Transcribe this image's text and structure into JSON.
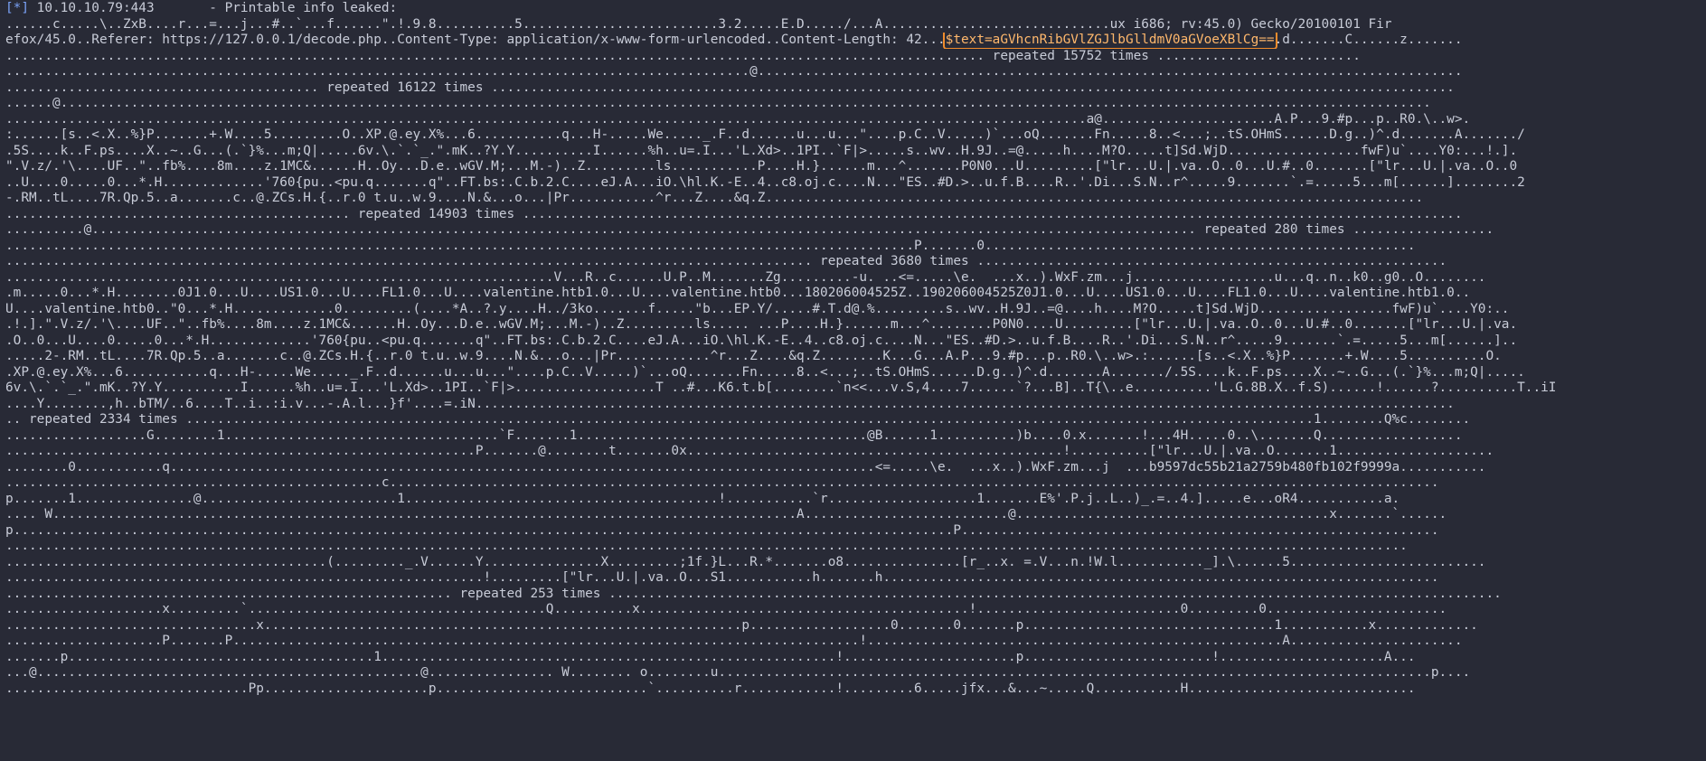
{
  "terminal": {
    "header": {
      "prefix": "[*]",
      "rest": " 10.10.10.79:443       - Printable info leaked:"
    },
    "line_2": {
      "before": "......c.....\\..ZxB....r...=...j...#..`...f......\".!.9.8..........5.........................3.2.....E.D...../...A.............................ux i686; rv:45.0) Gecko/20100101 Fir",
      "after": ""
    },
    "line_3": {
      "before": "efox/45.0..Referer: https://127.0.0.1/decode.php..Content-Type: application/x-www-form-urlencoded..Content-Length: 42...",
      "leak": "$text=aGVhcnRibGVlZGJlbGlldmV0aGVoeXBlCg==",
      "after": ".d.......C......z......."
    },
    "lines": [
      "............................................................................................................................. repeated 15752 times ..........................",
      "...............................................................................................@..........................................................................................",
      "........................................ repeated 16122 times ...........................................................................................................................",
      "......@...............................................................................................................................................................................",
      "..........................................................................................................................................a@......................A.P...9.#p...p..R0.\\..w>.",
      ":......[s..<.X..%}P.......+.W....5.........O..XP.@.ey.X%...6...........q...H-.....We....._.F..d......u...u...\"....p.C..V.....)`...oQ.......Fn.....8..<...;..tS.OHmS......D.g..)^.d.......A......./",
      ".5S....k..F.ps....X..~..G...(.`}%...m;Q|.....6v.\\.`.`_.\".mK..?Y.Y..........I......%h..u=.I...'L.Xd>..1PI..`F|>.....s..wv..H.9J..=@.....h....M?O.....t]Sd.WjD.................fwF)u`....Y0:...!.].",
      "\".V.z/.'\\....UF..\"..fb%....8m....z.1MC&......H..Oy...D.e..wGV.M;...M.-)..Z.........ls...........P....H.}......m...^.......P0N0...U.........[\"lr...U.|.va..O..0...U.#..0.......[\"lr...U.|.va..O..0",
      "..U....0.....0...*.H.............'760{pu..<pu.q.......q\"..FT.bs:.C.b.2.C....eJ.A...iO.\\hl.K.-E..4..c8.oj.c....N...\"ES..#D.>..u.f.B....R..'.Di...S.N..r^.....9.......`.=.....5...m[......]........2",
      "-.RM..tL....7R.Qp.5..a.......c..@.ZCs.H.{..r.0 t.u..w.9....N.&...o...|Pr...........^r...Z....&q.Z....................................................................................",
      "............................................ repeated 14903 times ........................................................................................................................",
      "..........@............................................................................................................................................. repeated 280 times ..................",
      "....................................................................................................................P.......0.......................................................",
      "....................................................................................................... repeated 3680 times ............................................................",
      "......................................................................V...R..c......U.P..M.......Zg.........-u. ..<=.....\\e.  ...x..).WxF.zm...j..................u...q..n..k0..g0..O........",
      ".m.....0...*.H........0J1.0...U....US1.0...U....FL1.0...U....valentine.htb1.0...U....valentine.htb0...180206004525Z..190206004525Z0J1.0...U....US1.0...U....FL1.0...U....valentine.htb1.0..",
      "U....valentine.htb0..\"0...*.H.............0.........(....*A..?.y....H../3ko.......f.....\"b...EP.Y/.....#.T.d@.%.........s..wv..H.9J..=@....h....M?O.....t]Sd.WjD.................fwF)u`....Y0:..",
      ".!.].\".V.z/.'\\....UF..\"..fb%....8m....z.1MC&......H..Oy...D.e..wGV.M;...M.-)..Z.........ls..... ...P....H.}......m...^........P0N0....U.........[\"lr...U.|.va..O..0...U.#..0.......[\"lr...U.|.va.",
      ".O..0...U....0.....0...*.H.............'760{pu..<pu.q.......q\"..FT.bs:.C.b.2.C....eJ.A...iO.\\hl.K.-E..4..c8.oj.c....N...\"ES..#D.>..u.f.B....R..'.Di...S.N..r^.....9.......`.=.....5...m[......]..",
      ".....2-.RM..tL....7R.Qp.5..a.......c..@.ZCs.H.{..r.0 t.u..w.9....N.&...o...|Pr............^r...Z....&q.Z........K...G...A.P...9.#p...p..R0.\\..w>.:......[s..<.X..%}P.......+.W....5..........O.",
      ".XP.@.ey.X%...6...........q...H-.....We....._.F..d......u...u...\"....p.C..V.....)`...oQ.......Fn.....8..<...;..tS.OHmS......D.g..)^.d.......A......./.5S....k..F.ps....X..~..G...(.`}%...m;Q|.....",
      "6v.\\.`.`_.\".mK..?Y.Y..........I......%h..u=.I...'L.Xd>..1PI..`F|>..................T ..#...K6.t.b[........`n<<...v.S,4....7......`?...B]..T{\\..e..........'L.G.8B.X..f.S)......!......?..........T..iI",
      "....Y........,h..bTM/..6....T..i..:i.v...-.A.l...}f'....=.iN.............................................................................................................................",
      ".. repeated 2334 times ................................................................................................................................................1........Q%c........",
      "..................G........1...................................`F.......1.....................................@B......1..........)b....0.x.......!...4H.....0..\\.......Q..................",
      "............................................................P.......@........t.......0x................................................!..........[\"lr...U.|.va..O.......1....................",
      "........0...........q..........................................................................................<=.....\\e.  ...x..).WxF.zm...j  ...b9597dc55b21a2759b480fb102f9999a...........",
      "................................................c......................................................................................................................................",
      "p.......1...............@.........................1........................................!...........`r...................1.......E%'.P.j..L..)_.=..4.].....e...oR4...........a.",
      ".... W...............................................................................................A..........................@........................................x.......`......",
      "p........................................................................................................................P.............................................................",
      "...................................................................................................................................................................................",
      ".........................................(........._.V......Y...............X.........;1f.}L...R.*.......o8...............[r_..x. =.V...n.!W.l..........._].\\......5.........................",
      ".............................................................!.........[\"lr...U.|.va..O...S1...........h.......h.......................................................................",
      "......................................................... repeated 253 times ..................................................................................................................",
      "....................x.........`......................................Q..........x..........................................!..........................0.........0.......................",
      "................................x.............................................................p..................0.......0.......p................................1...........x.............",
      "....................P.......P................................................................................!.....................................................A......................",
      ".......p.......................................1..........................................................!......................p........................!.....................A...",
      "...@.................................................@................ W........ o........u...........................................................................................p....",
      "...............................Pp.....................p...........................`..........r............!.........6.....jfx...&...~.....Q...........H............................."
    ]
  }
}
